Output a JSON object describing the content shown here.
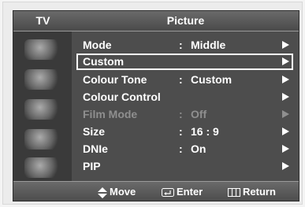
{
  "header": {
    "source": "TV",
    "title": "Picture"
  },
  "sidebar": {
    "icons": [
      "input-icon",
      "picture-icon",
      "sound-icon",
      "channel-icon",
      "setup-icon"
    ]
  },
  "menu": {
    "separator": ":",
    "items": [
      {
        "label": "Mode",
        "value": "Middle",
        "selected": false,
        "disabled": false
      },
      {
        "label": "Custom",
        "value": "",
        "selected": true,
        "disabled": false
      },
      {
        "label": "Colour Tone",
        "value": "Custom",
        "selected": false,
        "disabled": false
      },
      {
        "label": "Colour Control",
        "value": "",
        "selected": false,
        "disabled": false
      },
      {
        "label": "Film Mode",
        "value": "Off",
        "selected": false,
        "disabled": true
      },
      {
        "label": "Size",
        "value": "16 : 9",
        "selected": false,
        "disabled": false
      },
      {
        "label": "DNIe",
        "value": "On",
        "selected": false,
        "disabled": false
      },
      {
        "label": "PIP",
        "value": "",
        "selected": false,
        "disabled": false
      }
    ]
  },
  "footer": {
    "move": "Move",
    "enter": "Enter",
    "return": "Return"
  }
}
